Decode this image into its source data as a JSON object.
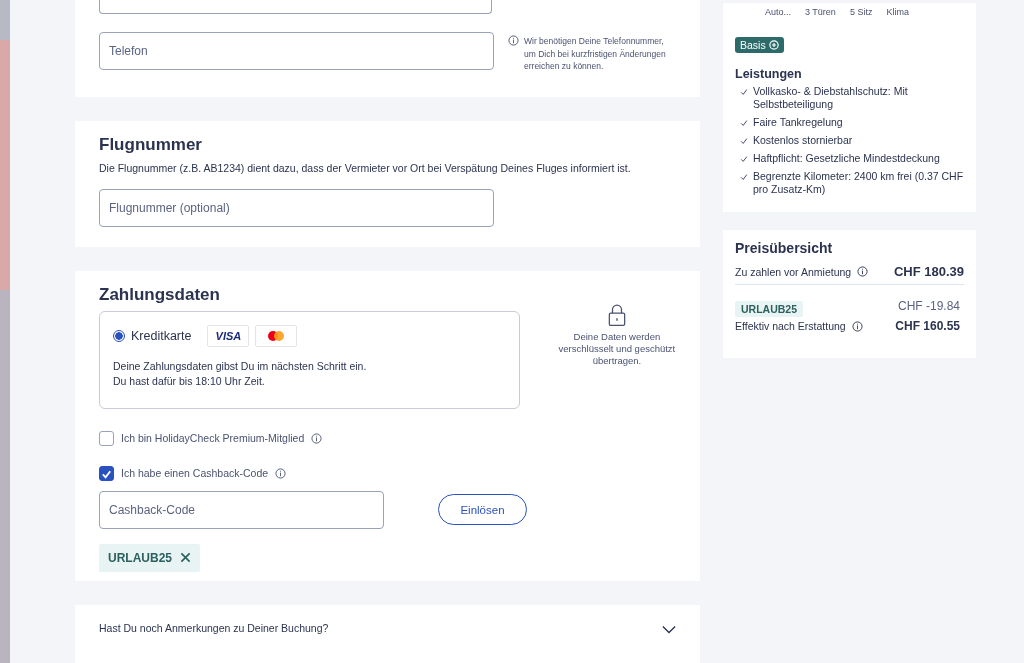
{
  "contact": {
    "phone_field": {
      "placeholder": "Telefon"
    },
    "phone_hint": "Wir benötigen Deine Telefonnummer, um Dich bei kurzfristigen Änderungen erreichen zu können."
  },
  "flight": {
    "title": "Flugnummer",
    "description": "Die Flugnummer (z.B. AB1234) dient dazu, dass der Vermieter vor Ort bei Verspätung Deines Fluges informiert ist.",
    "field": {
      "placeholder": "Flugnummer (optional)"
    }
  },
  "payment": {
    "title": "Zahlungsdaten",
    "methods": [
      {
        "label": "Kreditkarte",
        "selected": true,
        "visa": "VISA"
      }
    ],
    "notes": [
      "Deine Zahlungsdaten gibst Du im nächsten Schritt ein.",
      "Du hast dafür bis 18:10 Uhr Zeit."
    ],
    "security_note": "Deine Daten werden verschlüsselt und geschützt übertragen.",
    "options": [
      {
        "label": "Ich bin HolidayCheck Premium-Mitglied",
        "checked": false
      },
      {
        "label": "Ich habe einen Cashback-Code",
        "checked": true
      }
    ],
    "cashback_field": {
      "placeholder": "Cashback-Code"
    },
    "redeem_button": "Einlösen",
    "applied_code": "URLAUB25"
  },
  "remarks": {
    "label": "Hast Du noch Anmerkungen zu Deiner Buchung?",
    "expanded": false
  },
  "car": {
    "features": [
      "Auto...",
      "3 Türen",
      "5 Sitz",
      "Klima"
    ],
    "tariff": "Basis",
    "services_title": "Leistungen",
    "services": [
      "Vollkasko- & Diebstahlschutz: Mit Selbstbeteiligung",
      "Faire Tankregelung",
      "Kostenlos stornierbar",
      "Haftpflicht: Gesetzliche Mindestdeckung",
      "Begrenzte Kilometer: 2400 km frei (0.37 CHF pro Zusatz-Km)"
    ]
  },
  "price": {
    "title": "Preisübersicht",
    "due_label": "Zu zahlen vor Anmietung",
    "due_amount": "CHF 180.39",
    "code": "URLAUB25",
    "discount": "CHF -19.84",
    "effective_label": "Effektiv nach Erstattung",
    "effective_amount": "CHF 160.55"
  }
}
